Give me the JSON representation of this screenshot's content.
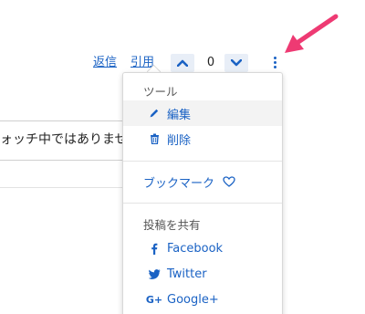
{
  "actions": {
    "reply_label": "返信",
    "quote_label": "引用",
    "vote_count": "0"
  },
  "background": {
    "text": "ォッチ中ではありませ"
  },
  "menu": {
    "tools_heading": "ツール",
    "edit_label": "編集",
    "delete_label": "削除",
    "bookmark_label": "ブックマーク",
    "share_heading": "投稿を共有",
    "share_items": [
      {
        "label": "Facebook",
        "icon": "facebook-icon"
      },
      {
        "label": "Twitter",
        "icon": "twitter-icon"
      },
      {
        "label": "Google+",
        "icon": "google-plus-icon"
      }
    ]
  },
  "colors": {
    "link": "#1a62c4",
    "arrow": "#ee3a73",
    "vote_bg": "#e8eef7"
  }
}
